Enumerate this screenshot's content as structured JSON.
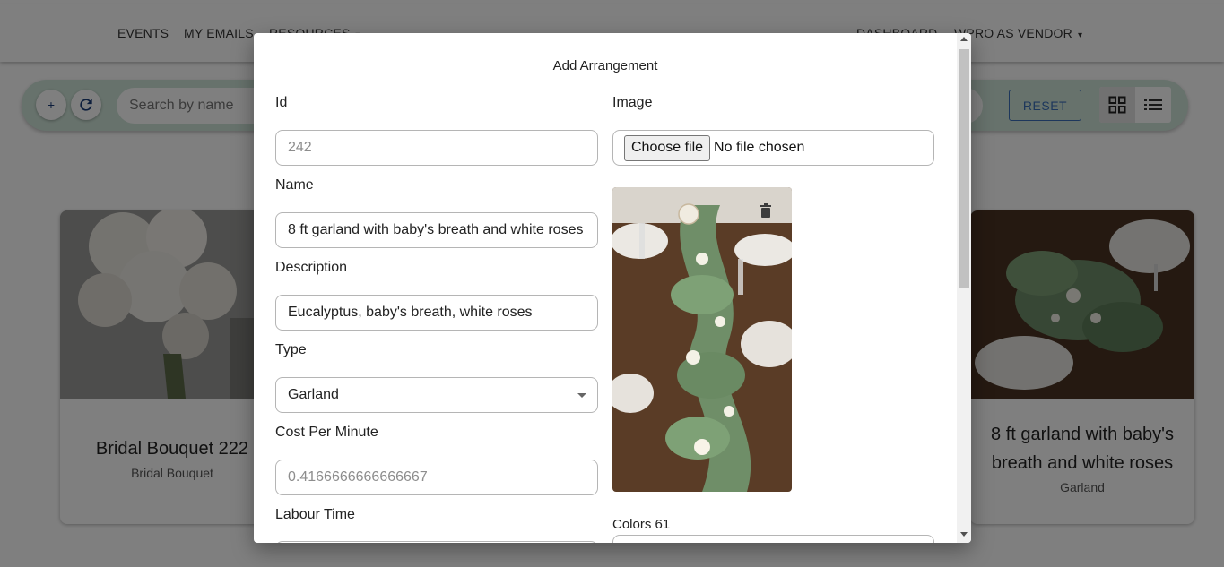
{
  "nav": {
    "left_items": [
      "EVENTS",
      "MY EMAILS",
      "RESOURCES"
    ],
    "right_items": [
      "DASHBOARD",
      "WPRO AS VENDOR"
    ]
  },
  "toolbar": {
    "add_label": "+",
    "search_placeholder": "Search by name",
    "reset_label": "RESET"
  },
  "cards": [
    {
      "title": "Bridal Bouquet 222",
      "subtitle": "Bridal Bouquet"
    },
    {
      "title": "8 ft garland with baby's breath and white roses",
      "subtitle": "Garland"
    }
  ],
  "modal": {
    "title": "Add Arrangement",
    "id_label": "Id",
    "id_placeholder": "242",
    "name_label": "Name",
    "name_value": "8 ft garland with baby's breath and white roses",
    "description_label": "Description",
    "description_value": "Eucalyptus, baby's breath, white roses",
    "type_label": "Type",
    "type_value": "Garland",
    "cost_label": "Cost Per Minute",
    "cost_placeholder": "0.4166666666666667",
    "labour_label": "Labour Time",
    "image_label": "Image",
    "file_button": "Choose file",
    "file_status": "No file chosen",
    "colors_label": "Colors 61"
  },
  "colors": {
    "toolbar_bg": "#cfe5d9",
    "accent_blue": "#3a6fb8",
    "overlay": "rgba(0,0,0,0.5)"
  }
}
